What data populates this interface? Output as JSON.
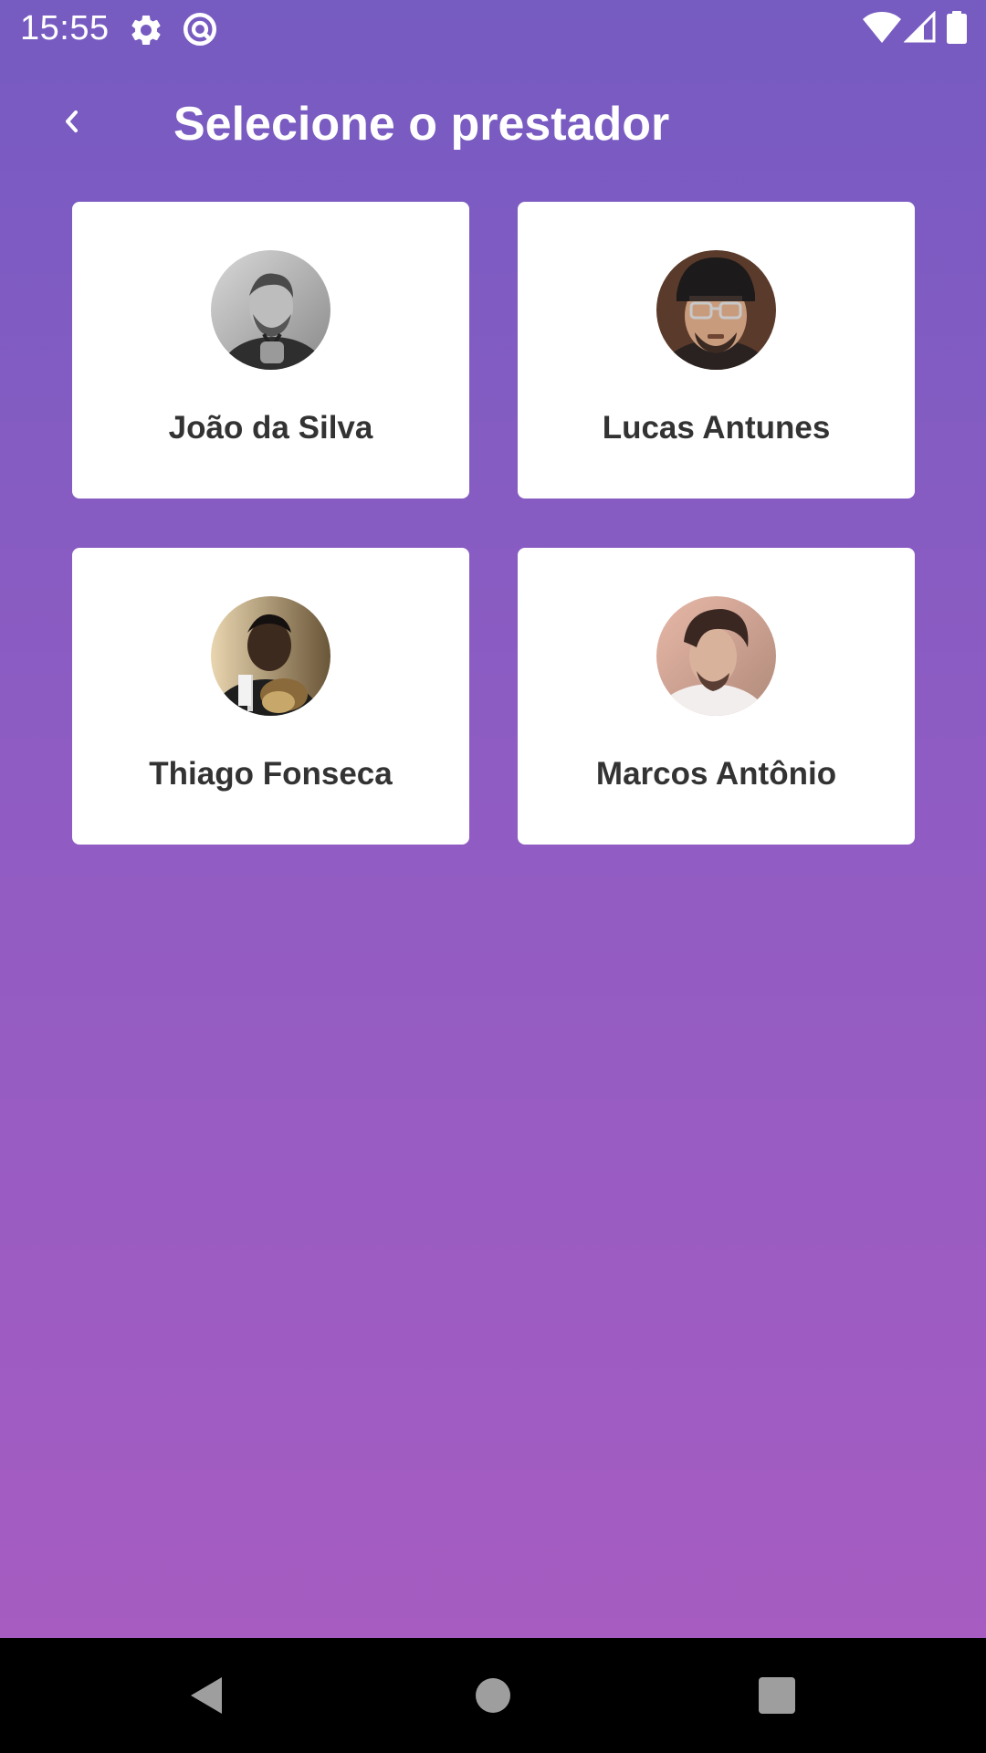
{
  "status_bar": {
    "time": "15:55",
    "icons": [
      "settings-icon",
      "do-not-disturb-icon",
      "wifi-icon",
      "signal-icon",
      "battery-icon"
    ]
  },
  "app_bar": {
    "back_icon": "chevron-left-icon",
    "title": "Selecione o prestador"
  },
  "providers": [
    {
      "name": "João da Silva",
      "avatar": "avatar-photo"
    },
    {
      "name": "Lucas Antunes",
      "avatar": "avatar-photo"
    },
    {
      "name": "Thiago Fonseca",
      "avatar": "avatar-photo"
    },
    {
      "name": "Marcos Antônio",
      "avatar": "avatar-photo"
    }
  ],
  "nav_bar": {
    "icons": [
      "nav-back-icon",
      "nav-home-icon",
      "nav-recents-icon"
    ]
  },
  "colors": {
    "background_top": "#765bc1",
    "background_bottom": "#a95cc1",
    "card": "#ffffff",
    "name_text": "#333333"
  }
}
